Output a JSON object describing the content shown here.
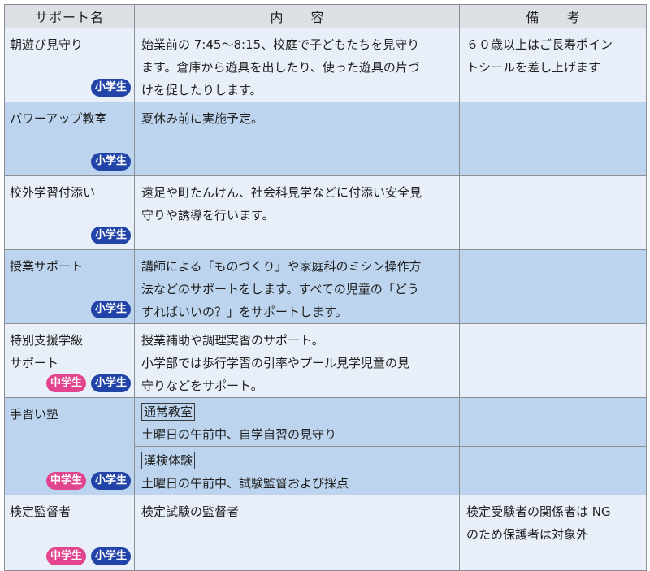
{
  "header": {
    "col_name": "サポート名",
    "col_content": "内容",
    "col_note": "備考"
  },
  "badges": {
    "elementary": "小学生",
    "junior": "中学生"
  },
  "colors": {
    "header_bg": "#dcdfe3",
    "light_row": "#e8eff9",
    "dark_row": "#bcd4ee",
    "elementary_badge": "#2244a8",
    "junior_badge": "#e2458e"
  },
  "rows": [
    {
      "name": "朝遊び見守り",
      "content": [
        "始業前の 7:45～8:15、校庭で子どもたちを見守り",
        "ます。倉庫から遊具を出したり、使った遊具の片づ",
        "けを促したりします。"
      ],
      "note": [
        "６０歳以上はご長寿ポイン",
        "トシールを差し上げます"
      ]
    },
    {
      "name": "パワーアップ教室",
      "content": [
        "夏休み前に実施予定。"
      ]
    },
    {
      "name": "校外学習付添い",
      "content": [
        "遠足や町たんけん、社会科見学などに付添い安全見",
        "守りや誘導を行います。"
      ]
    },
    {
      "name": "授業サポート",
      "content": [
        "講師による「ものづくり」や家庭科のミシン操作方",
        "法などのサポートをします。すべての児童の「どう",
        "すればいいの？」をサポートします。"
      ]
    },
    {
      "name": [
        "特別支援学級",
        "サポート"
      ],
      "content": [
        "授業補助や調理実習のサポート。",
        "小学部では歩行学習の引率やプール見学児童の見",
        "守りなどをサポート。"
      ]
    },
    {
      "name": "手習い塾",
      "sub": [
        {
          "title": "通常教室",
          "text": "土曜日の午前中、自学自習の見守り"
        },
        {
          "title": "漢検体験",
          "text": "土曜日の午前中、試験監督および採点"
        }
      ]
    },
    {
      "name": "検定監督者",
      "content": [
        "検定試験の監督者"
      ],
      "note": [
        "検定受験者の関係者は NG",
        "のため保護者は対象外"
      ]
    }
  ]
}
